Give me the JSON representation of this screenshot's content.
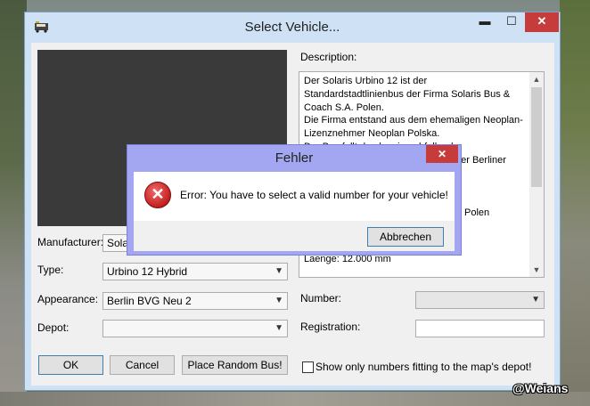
{
  "window": {
    "title": "Select Vehicle...",
    "min_glyph": "▬",
    "max_glyph": "☐",
    "close_glyph": "✕"
  },
  "form": {
    "manufacturer_label": "Manufacturer:",
    "manufacturer_value": "Solar",
    "type_label": "Type:",
    "type_value": "Urbino 12 Hybrid",
    "appearance_label": "Appearance:",
    "appearance_value": "Berlin BVG Neu 2",
    "depot_label": "Depot:",
    "depot_value": "",
    "description_label": "Description:",
    "number_label": "Number:",
    "number_value": "",
    "registration_label": "Registration:",
    "registration_value": "",
    "dropdown_glyph": "▼"
  },
  "description": {
    "lines": [
      "Der Solaris Urbino 12 ist der",
      "Standardstadtlinienbus der Firma Solaris Bus &",
      "Coach S.A. Polen.",
      "Die Firma entstand aus dem ehemaligen Neoplan-",
      "Lizenznehmer Neoplan Polska.",
      "Der Bus fallt durch seine abfallende",
      "der Berliner",
      "Polen",
      "Laenge: 12.000 mm"
    ]
  },
  "buttons": {
    "ok": "OK",
    "cancel": "Cancel",
    "random": "Place Random Bus!"
  },
  "checkbox": {
    "label": "Show only numbers fitting to the map's depot!",
    "checked": false
  },
  "error_dialog": {
    "title": "Fehler",
    "message": "Error: You have to select a valid number for your vehicle!",
    "button": "Abbrechen",
    "close_glyph": "✕",
    "icon_glyph": "✕"
  },
  "watermark": "@Weians",
  "colors": {
    "window_frame": "#cfe2f5",
    "dialog_frame": "#a3a6f0",
    "close_red": "#c63b3b",
    "preview_bg": "#3a3a3a"
  },
  "icons": {
    "app": "bus-app-icon",
    "error": "error-icon"
  }
}
